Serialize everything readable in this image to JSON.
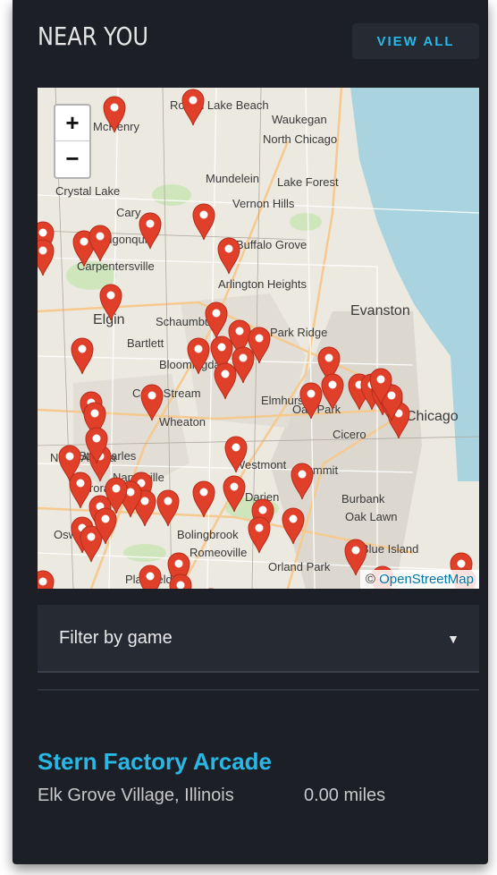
{
  "header": {
    "title": "NEAR YOU",
    "view_all_label": "VIEW ALL"
  },
  "map": {
    "zoom_in_label": "+",
    "zoom_out_label": "−",
    "attribution_symbol": "©",
    "attribution_text": "OpenStreetMap",
    "water_color": "#a9d3df",
    "pin_color": "#e0402a",
    "place_labels": [
      "Round Lake Beach",
      "Waukegan",
      "North Chicago",
      "McHenry",
      "Mundelein",
      "Lake Forest",
      "Crystal Lake",
      "Cary",
      "Vernon Hills",
      "Algonquin",
      "Buffalo Grove",
      "Carpentersville",
      "Arlington Heights",
      "Elgin",
      "Schaumburg",
      "Evanston",
      "Bartlett",
      "Park Ridge",
      "Bloomingdale",
      "Carol Stream",
      "Elmhurst",
      "Oak Park",
      "Wheaton",
      "Chicago",
      "St. Charles",
      "North Aurora",
      "Cicero",
      "Naperville",
      "Westmont",
      "Summit",
      "Aurora",
      "Darien",
      "Burbank",
      "Oak Lawn",
      "Oswego",
      "Bolingbrook",
      "Romeoville",
      "Blue Island",
      "Orland Park",
      "Plainfield"
    ]
  },
  "filter": {
    "label": "Filter by game",
    "caret": "▼"
  },
  "result": {
    "name": "Stern Factory Arcade",
    "location": "Elk Grove Village, Illinois",
    "distance": "0.00 miles"
  }
}
